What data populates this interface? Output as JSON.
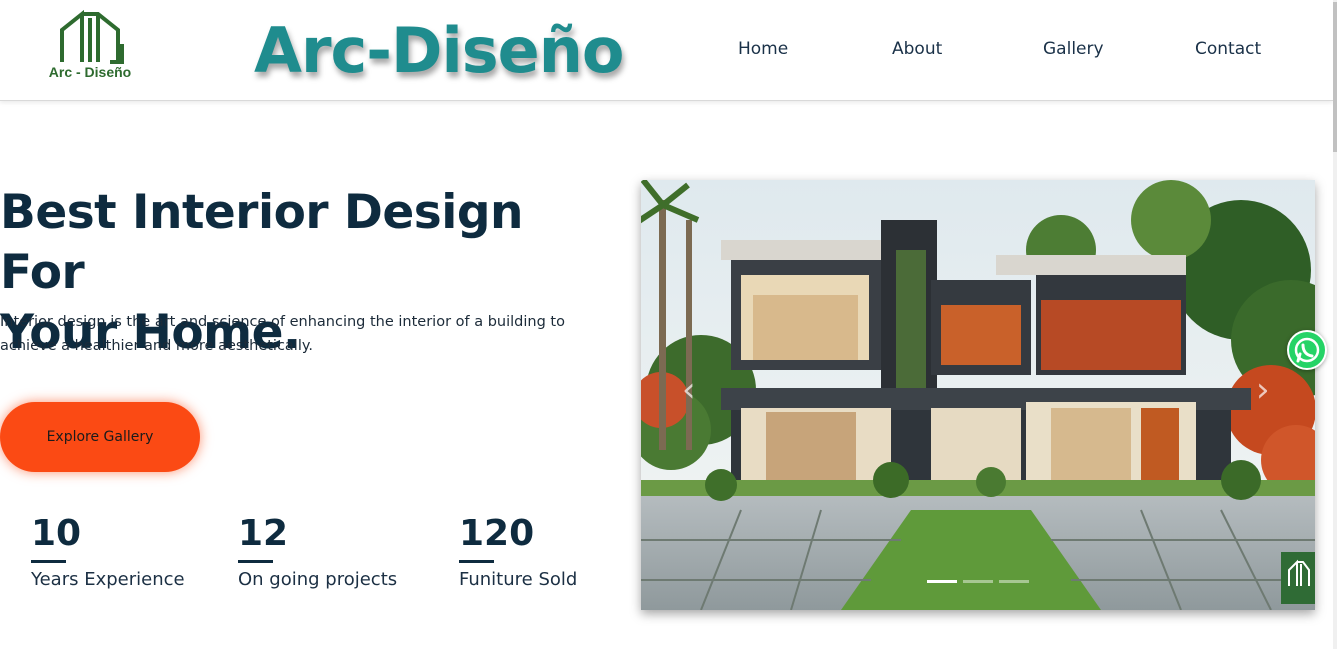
{
  "header": {
    "logo_text": "Arc - Diseño",
    "brand": "Arc-Diseño",
    "nav": [
      "Home",
      "About",
      "Gallery",
      "Contact"
    ]
  },
  "hero": {
    "title_line1": "Best Interior Design For",
    "title_line2": "Your Home.",
    "description": "Interior design is the art and science of enhancing the interior of a building to achieve a healthier and more aesthetically.",
    "cta_label": "Explore Gallery"
  },
  "stats": [
    {
      "value": "10",
      "label": "Years Experience"
    },
    {
      "value": "12",
      "label": "On going projects"
    },
    {
      "value": "120",
      "label": "Funiture Sold"
    }
  ],
  "carousel": {
    "slide_count": 3,
    "active_slide": 1
  },
  "colors": {
    "brand": "#1f8c8e",
    "accent": "#fb4a14",
    "heading": "#0e2b3f",
    "logo_green": "#2e6b2f",
    "whatsapp": "#25d366"
  },
  "icons": [
    "logo-house-icon",
    "chevron-left-icon",
    "chevron-right-icon",
    "whatsapp-icon"
  ]
}
